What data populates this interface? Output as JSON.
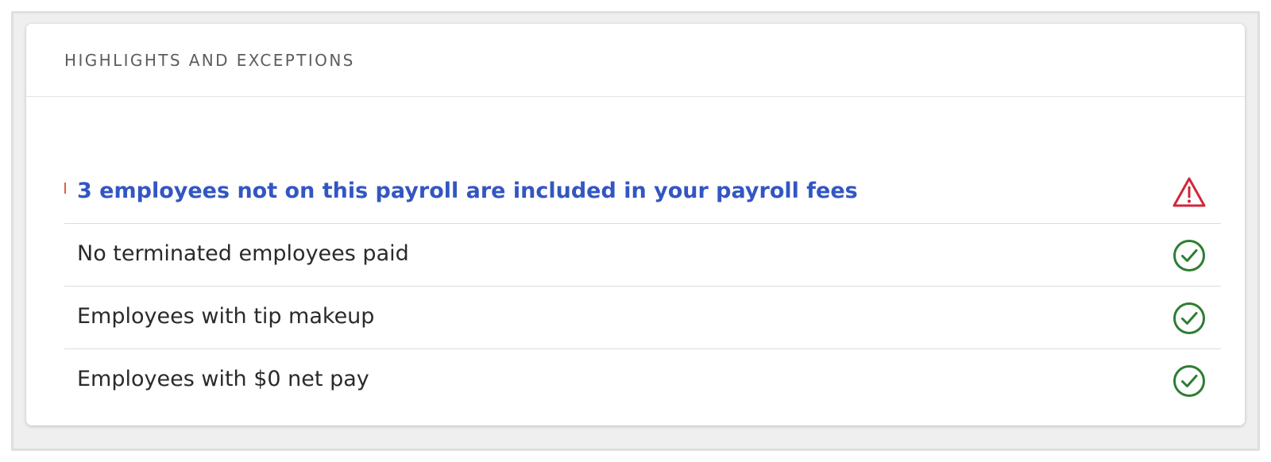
{
  "card": {
    "title": "HIGHLIGHTS AND EXCEPTIONS"
  },
  "items": [
    {
      "label": "3 employees not on this payroll are included in your payroll fees",
      "status": "warning",
      "icon": "warning-triangle-icon"
    },
    {
      "label": "No terminated employees paid",
      "status": "ok",
      "icon": "check-circle-icon"
    },
    {
      "label": "Employees with tip makeup",
      "status": "ok",
      "icon": "check-circle-icon"
    },
    {
      "label": "Employees with $0 net pay",
      "status": "ok",
      "icon": "check-circle-icon"
    }
  ],
  "colors": {
    "link": "#3356c2",
    "warning": "#d0263a",
    "success": "#2e7d32",
    "title": "#5d5d5d"
  }
}
